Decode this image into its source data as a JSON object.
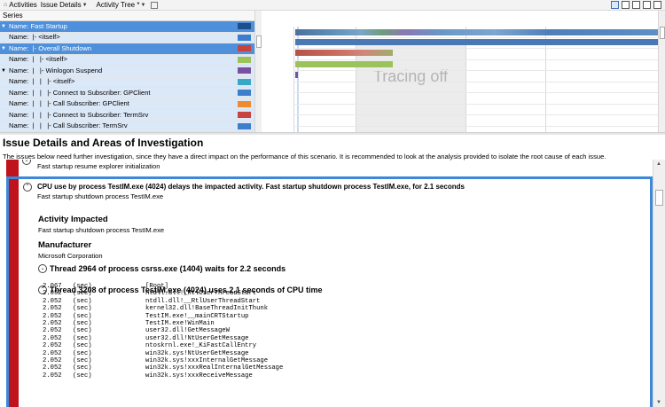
{
  "toolbar": {
    "activities_label": "Activities",
    "issue_details_label": "Issue Details",
    "activity_tree_label": "Activity Tree *"
  },
  "series": {
    "header": "Series",
    "rows": [
      {
        "label": "Name: Fast Startup",
        "selected": true,
        "expander": "▼",
        "color": "#1f4e8c"
      },
      {
        "label": "Name:  |- <itself>",
        "selected": false,
        "expander": "",
        "color": "#3d7dcc"
      },
      {
        "label": "Name:  |- Overall Shutdown",
        "selected": true,
        "expander": "▼",
        "color": "#c8433d"
      },
      {
        "label": "Name:  |   |- <itself>",
        "selected": false,
        "expander": "",
        "color": "#9bc25b"
      },
      {
        "label": "Name:  |   |- Winlogon Suspend",
        "selected": false,
        "expander": "▼",
        "color": "#7b4fa0"
      },
      {
        "label": "Name:  |   |   |- <itself>",
        "selected": false,
        "expander": "",
        "color": "#3ba7c6"
      },
      {
        "label": "Name:  |   |   |- Connect to Subscriber: GPClient",
        "selected": false,
        "expander": "",
        "color": "#3d7dcc"
      },
      {
        "label": "Name:  |   |   |- Call Subscriber: GPClient",
        "selected": false,
        "expander": "",
        "color": "#f08a2e"
      },
      {
        "label": "Name:  |   |   |- Connect to Subscriber: TermSrv",
        "selected": false,
        "expander": "",
        "color": "#c8433d"
      },
      {
        "label": "Name:  |   |   |- Call Subscriber: TermSrv",
        "selected": false,
        "expander": "",
        "color": "#3d7dcc"
      }
    ]
  },
  "timeline": {
    "tracing_off": "Tracing off"
  },
  "issue": {
    "title": "Issue Details and Areas of Investigation",
    "description": "The issues below need further investigation, since they have a direct impact on the performance of this scenario. It is recommended to look at the analysis provided to isolate the root cause of each issue.",
    "prev_item": "Fast startup resume explorer initialization",
    "card_heading": "CPU use by process TestIM.exe (4024) delays the impacted activity. Fast startup shutdown process TestIM.exe, for 2.1 seconds",
    "card_sub": "Fast startup shutdown process TestIM.exe",
    "activity_impacted_title": "Activity Impacted",
    "activity_impacted_text": "Fast startup shutdown process TestIM.exe",
    "manufacturer_title": "Manufacturer",
    "manufacturer_text": "Microsoft Corporation",
    "thread1": "Thread 2964 of process csrss.exe (1404) waits for 2.2 seconds",
    "thread2": "Thread 3208 of process TestIM.exe (4024) uses 2.1 seconds of CPU time"
  },
  "stack": [
    {
      "value": "2.067",
      "unit": "(sec)",
      "frame": "[Root]"
    },
    {
      "value": "2.052",
      "unit": "(sec)",
      "frame": "ntdll.dll!_RtlUserThreadStart"
    },
    {
      "value": "2.052",
      "unit": "(sec)",
      "frame": "ntdll.dll!__RtlUserThreadStart"
    },
    {
      "value": "2.052",
      "unit": "(sec)",
      "frame": "kernel32.dll!BaseThreadInitThunk"
    },
    {
      "value": "2.052",
      "unit": "(sec)",
      "frame": "TestIM.exe!__mainCRTStartup"
    },
    {
      "value": "2.052",
      "unit": "(sec)",
      "frame": "TestIM.exe!WinMain"
    },
    {
      "value": "2.052",
      "unit": "(sec)",
      "frame": "user32.dll!GetMessageW"
    },
    {
      "value": "2.052",
      "unit": "(sec)",
      "frame": "user32.dll!NtUserGetMessage"
    },
    {
      "value": "2.052",
      "unit": "(sec)",
      "frame": "ntoskrnl.exe!_KiFastCallEntry"
    },
    {
      "value": "2.052",
      "unit": "(sec)",
      "frame": "win32k.sys!NtUserGetMessage"
    },
    {
      "value": "2.052",
      "unit": "(sec)",
      "frame": "win32k.sys!xxxInternalGetMessage"
    },
    {
      "value": "2.052",
      "unit": "(sec)",
      "frame": "win32k.sys!xxxRealInternalGetMessage"
    },
    {
      "value": "2.052",
      "unit": "(sec)",
      "frame": "win32k.sys!xxxReceiveMessage"
    }
  ]
}
